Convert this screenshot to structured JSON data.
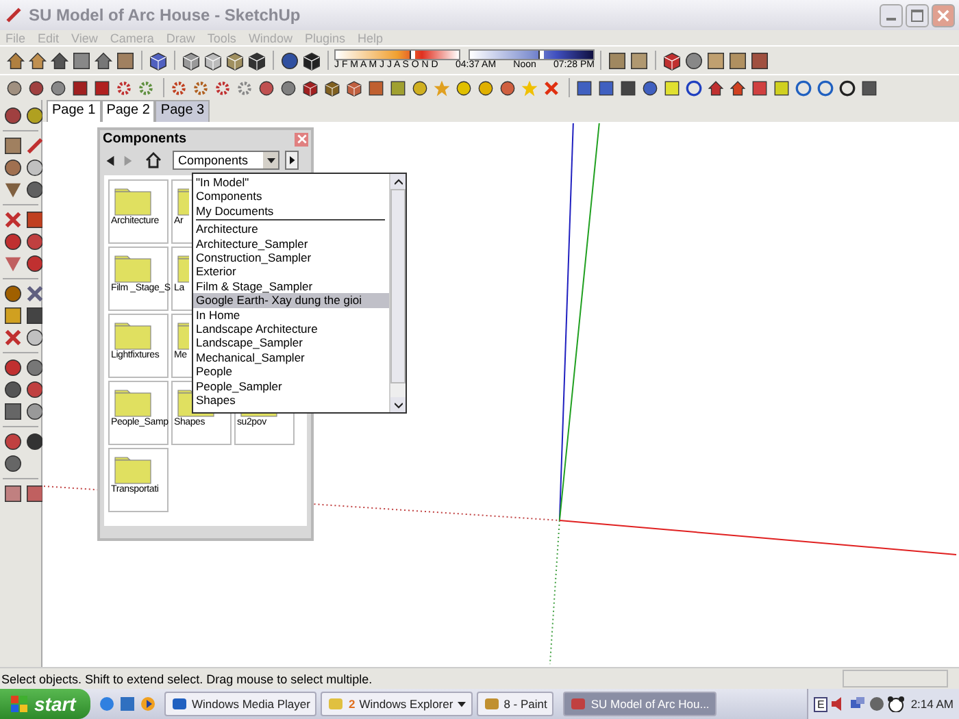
{
  "window": {
    "title": "SU Model of Arc House - SketchUp"
  },
  "menu": [
    "File",
    "Edit",
    "View",
    "Camera",
    "Draw",
    "Tools",
    "Window",
    "Plugins",
    "Help"
  ],
  "shadow_toolbar": {
    "date_slider": {
      "level": 0.6
    },
    "time_slider": {
      "level": 0.55
    },
    "months": "J F M A M J J A S O N D",
    "sunrise": "04:37 AM",
    "noon": "Noon",
    "sunset": "07:28 PM"
  },
  "tabs": [
    {
      "label": "Page 1",
      "selected": false
    },
    {
      "label": "Page 2",
      "selected": false
    },
    {
      "label": "Page 3",
      "selected": true
    }
  ],
  "components": {
    "title": "Components",
    "collection": "Components",
    "tile_rows": [
      [
        {
          "label": "Architecture"
        },
        {
          "label": "Ar"
        }
      ],
      [
        {
          "label": "Film _Stage_S"
        },
        {
          "label": "La"
        }
      ],
      [
        {
          "label": "Lightfixtures"
        },
        {
          "label": "Me"
        }
      ],
      [
        {
          "label": "People_Samp"
        },
        {
          "label": "Shapes"
        },
        {
          "label": "su2pov"
        }
      ],
      [
        {
          "label": "Transportati"
        }
      ]
    ],
    "dropdown": {
      "locations": [
        {
          "label": "\"In Model\"",
          "selected": false
        },
        {
          "label": "Components",
          "selected": false
        },
        {
          "label": "My Documents",
          "selected": false
        }
      ],
      "collections": [
        {
          "label": "Architecture",
          "selected": false
        },
        {
          "label": "Architecture_Sampler",
          "selected": false
        },
        {
          "label": "Construction_Sampler",
          "selected": false
        },
        {
          "label": "Exterior",
          "selected": false
        },
        {
          "label": "Film & Stage_Sampler",
          "selected": false
        },
        {
          "label": "Google Earth- Xay dung the gioi",
          "selected": true
        },
        {
          "label": "In Home",
          "selected": false
        },
        {
          "label": "Landscape Architecture",
          "selected": false
        },
        {
          "label": "Landscape_Sampler",
          "selected": false
        },
        {
          "label": "Mechanical_Sampler",
          "selected": false
        },
        {
          "label": "People",
          "selected": false
        },
        {
          "label": "People_Sampler",
          "selected": false
        },
        {
          "label": "Shapes",
          "selected": false
        }
      ]
    }
  },
  "status_bar": {
    "text": "Select objects. Shift to extend select. Drag mouse to select multiple."
  },
  "taskbar": {
    "start": "start",
    "tasks": [
      {
        "label": "Windows Media Player",
        "selected": false,
        "kind": "player"
      },
      {
        "label": "Windows Explorer",
        "count": "2",
        "selected": false,
        "kind": "folder"
      },
      {
        "label": "8 - Paint",
        "selected": false,
        "kind": "paint"
      },
      {
        "label": "SU Model of Arc Hou...",
        "selected": true,
        "kind": "sketchup"
      }
    ],
    "language": "E",
    "clock": "2:14 AM"
  }
}
